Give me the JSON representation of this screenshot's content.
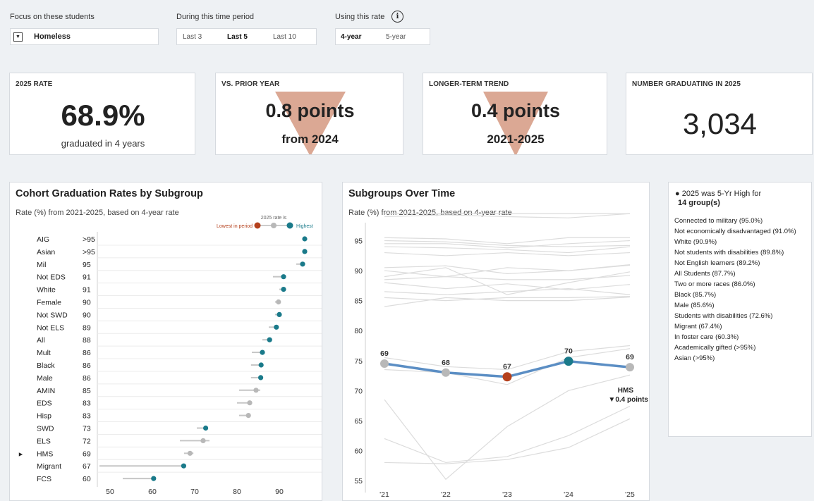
{
  "filters": {
    "students": {
      "label": "Focus on these students",
      "value": "Homeless"
    },
    "period": {
      "label": "During this time period",
      "options": [
        "Last 3",
        "Last 5",
        "Last 10"
      ],
      "selected": 1
    },
    "rate": {
      "label": "Using this rate",
      "options": [
        "4-year",
        "5-year"
      ],
      "selected": 0
    }
  },
  "cards": {
    "rate": {
      "title": "2025 RATE",
      "value": "68.9%",
      "sub": "graduated in 4 years"
    },
    "prior": {
      "title": "VS. PRIOR YEAR",
      "value": "0.8 points",
      "sub": "from 2024",
      "direction": "down"
    },
    "trend": {
      "title": "LONGER-TERM TREND",
      "value": "0.4 points",
      "sub": "2021-2025",
      "direction": "down"
    },
    "number": {
      "title": "NUMBER GRADUATING IN 2025",
      "value": "3,034"
    }
  },
  "colors": {
    "highest": "#1a7a8a",
    "lowest": "#b5401c",
    "neutral": "#b8b8b8",
    "hms_line": "#5b8ec4",
    "arrow": "#dba894"
  },
  "subgroups_panel": {
    "title": "Cohort Graduation Rates by Subgroup",
    "subtitle": "Rate (%) from 2021-2025, based on 4-year rate",
    "legend": {
      "caption": "2025 rate is",
      "lowest": "Lowest in period",
      "highest": "Highest"
    }
  },
  "over_time_panel": {
    "title": "Subgroups Over Time",
    "subtitle": "Rate (%) from 2021-2025, based on 4-year rate",
    "hms_label": "HMS",
    "hms_change": "▼0.4 points"
  },
  "highlights": {
    "title": "● 2025 was 5-Yr High for",
    "count": "14 group(s)",
    "items": [
      "Connected to military (95.0%)",
      "Not economically disadvantaged (91.0%)",
      "White (90.9%)",
      "Not students with disabilities (89.8%)",
      "Not English learners (89.2%)",
      "All Students (87.7%)",
      "Two or more races (86.0%)",
      "Black (85.7%)",
      "Male (85.6%)",
      "Students with disabilities (72.6%)",
      "Migrant (67.4%)",
      "In foster care (60.3%)",
      "Academically gifted (>95%)",
      "Asian (>95%)"
    ]
  },
  "chart_data": [
    {
      "type": "scatter",
      "title": "Cohort Graduation Rates by Subgroup",
      "subtitle": "Rate (%) from 2021-2025, based on 4-year rate",
      "xlim": [
        47,
        100
      ],
      "xticks": [
        "50",
        "60",
        "70",
        "80",
        "90"
      ],
      "rows": [
        {
          "name": "AIG",
          "label": ">95",
          "min": 95.5,
          "max": 96,
          "value": 96,
          "status": "highest"
        },
        {
          "name": "Asian",
          "label": ">95",
          "min": 96,
          "max": 96,
          "value": 96,
          "status": "highest"
        },
        {
          "name": "Mil",
          "label": "95",
          "min": 94,
          "max": 95.5,
          "value": 95.5,
          "status": "highest"
        },
        {
          "name": "Not EDS",
          "label": "91",
          "min": 88.5,
          "max": 91,
          "value": 91,
          "status": "highest"
        },
        {
          "name": "White",
          "label": "91",
          "min": 90,
          "max": 91,
          "value": 91,
          "status": "highest"
        },
        {
          "name": "Female",
          "label": "90",
          "min": 89,
          "max": 90,
          "value": 89.8,
          "status": "neutral"
        },
        {
          "name": "Not SWD",
          "label": "90",
          "min": 89,
          "max": 90,
          "value": 90,
          "status": "highest"
        },
        {
          "name": "Not ELS",
          "label": "89",
          "min": 87.5,
          "max": 89.3,
          "value": 89.3,
          "status": "highest"
        },
        {
          "name": "All",
          "label": "88",
          "min": 86,
          "max": 87.7,
          "value": 87.7,
          "status": "highest"
        },
        {
          "name": "Mult",
          "label": "86",
          "min": 83.5,
          "max": 86,
          "value": 86,
          "status": "highest"
        },
        {
          "name": "Black",
          "label": "86",
          "min": 83.3,
          "max": 85.7,
          "value": 85.7,
          "status": "highest"
        },
        {
          "name": "Male",
          "label": "86",
          "min": 83.3,
          "max": 85.6,
          "value": 85.6,
          "status": "highest"
        },
        {
          "name": "AMIN",
          "label": "85",
          "min": 80.5,
          "max": 85.5,
          "value": 84.5,
          "status": "neutral"
        },
        {
          "name": "EDS",
          "label": "83",
          "min": 80,
          "max": 83.3,
          "value": 83,
          "status": "neutral"
        },
        {
          "name": "Hisp",
          "label": "83",
          "min": 80.5,
          "max": 83,
          "value": 82.7,
          "status": "neutral"
        },
        {
          "name": "SWD",
          "label": "73",
          "min": 70.5,
          "max": 72.6,
          "value": 72.6,
          "status": "highest"
        },
        {
          "name": "ELS",
          "label": "72",
          "min": 66.5,
          "max": 73.5,
          "value": 72,
          "status": "neutral"
        },
        {
          "name": "HMS",
          "label": "69",
          "min": 67.5,
          "max": 69.7,
          "value": 68.9,
          "status": "neutral",
          "marked": true
        },
        {
          "name": "Migrant",
          "label": "67",
          "min": 47.5,
          "max": 67.4,
          "value": 67.4,
          "status": "highest"
        },
        {
          "name": "FCS",
          "label": "60",
          "min": 53,
          "max": 60.3,
          "value": 60.3,
          "status": "highest"
        }
      ]
    },
    {
      "type": "line",
      "title": "Subgroups Over Time",
      "subtitle": "Rate (%) from 2021-2025, based on 4-year rate",
      "x": [
        "'21",
        "'22",
        "'23",
        "'24",
        "'25"
      ],
      "ylim": [
        53,
        98
      ],
      "yticks": [
        "55",
        "60",
        "65",
        "70",
        "75",
        "80",
        "85",
        "90",
        "95"
      ],
      "highlight": {
        "name": "HMS",
        "values": [
          74.5,
          73,
          72.3,
          74.9,
          73.9
        ],
        "labels": [
          "69",
          "68",
          "67",
          "70",
          "69"
        ],
        "status": [
          "neutral",
          "neutral",
          "lowest",
          "highest",
          "neutral"
        ]
      },
      "background_series": [
        [
          99.5,
          99.5,
          99.5,
          99.5,
          99.5
        ],
        [
          99,
          99.3,
          99,
          98.8,
          99.5
        ],
        [
          95.5,
          95.3,
          94.5,
          95.5,
          95.5
        ],
        [
          94.5,
          94.5,
          93.8,
          94.5,
          95
        ],
        [
          95,
          94.8,
          94.2,
          94,
          94.2
        ],
        [
          94,
          93.8,
          93.5,
          93,
          94
        ],
        [
          93,
          92.5,
          93,
          92.5,
          93
        ],
        [
          90.5,
          90.8,
          89.5,
          90,
          91
        ],
        [
          90,
          89,
          90.5,
          90,
          90.9
        ],
        [
          89,
          90.5,
          86,
          88,
          89.8
        ],
        [
          88.5,
          89,
          88.5,
          88.5,
          89.2
        ],
        [
          88,
          87,
          87.8,
          86.8,
          87.7
        ],
        [
          86.5,
          86,
          86.5,
          87,
          86
        ],
        [
          85.5,
          85,
          85.5,
          85.5,
          85.7
        ],
        [
          84,
          85.5,
          85,
          85,
          85.6
        ],
        [
          75.5,
          74,
          73.5,
          76.5,
          77.5
        ],
        [
          73.5,
          73,
          71,
          75.5,
          77
        ],
        [
          68.5,
          55.2,
          64,
          70,
          72.6
        ],
        [
          62,
          58,
          59,
          62.5,
          67.4
        ],
        [
          58,
          57.8,
          58.5,
          60.5,
          65.3
        ]
      ]
    }
  ]
}
